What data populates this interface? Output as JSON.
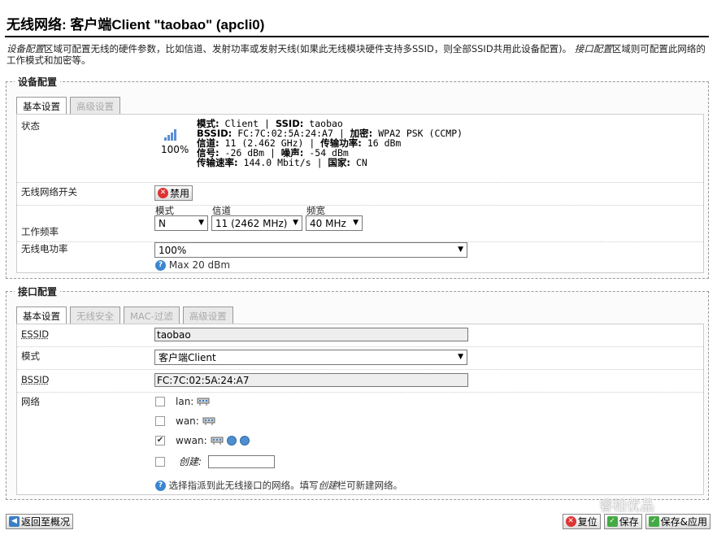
{
  "page": {
    "title": "无线网络: 客户端Client \"taobao\" (apcli0)",
    "desc_part1_italic": "设备配置",
    "desc_part1": "区域可配置无线的硬件参数，比如信道、发射功率或发射天线(如果此无线模块硬件支持多SSID，则全部SSID共用此设备配置)。",
    "desc_part2_italic": "接口配置",
    "desc_part2": "区域则可配置此网络的工作模式和加密等。"
  },
  "device_config": {
    "legend": "设备配置",
    "tabs": [
      {
        "label": "基本设置",
        "active": true
      },
      {
        "label": "高级设置",
        "active": false
      }
    ],
    "status": {
      "label": "状态",
      "signal_percent": "100%",
      "mode_label": "模式:",
      "mode_value": "Client",
      "ssid_label": "SSID:",
      "ssid_value": "taobao",
      "bssid_label": "BSSID:",
      "bssid_value": "FC:7C:02:5A:24:A7",
      "enc_label": "加密:",
      "enc_value": "WPA2 PSK (CCMP)",
      "channel_label": "信道:",
      "channel_value": "11 (2.462 GHz)",
      "txpower_label": "传输功率:",
      "txpower_value": "16 dBm",
      "signal_label": "信号:",
      "signal_value": "-26 dBm",
      "noise_label": "噪声:",
      "noise_value": "-54 dBm",
      "bitrate_label": "传输速率:",
      "bitrate_value": "144.0 Mbit/s",
      "country_label": "国家:",
      "country_value": "CN"
    },
    "wireless_switch": {
      "label": "无线网络开关",
      "button": "禁用"
    },
    "frequency": {
      "label": "工作频率",
      "mode_label": "模式",
      "mode_value": "N",
      "channel_label": "信道",
      "channel_value": "11 (2462 MHz)",
      "width_label": "频宽",
      "width_value": "40 MHz"
    },
    "power": {
      "label": "无线电功率",
      "value": "100%",
      "hint": "Max 20 dBm"
    }
  },
  "interface_config": {
    "legend": "接口配置",
    "tabs": [
      {
        "label": "基本设置",
        "active": true
      },
      {
        "label": "无线安全",
        "active": false
      },
      {
        "label": "MAC-过滤",
        "active": false
      },
      {
        "label": "高级设置",
        "active": false
      }
    ],
    "essid": {
      "label": "ESSID",
      "value": "taobao"
    },
    "mode": {
      "label": "模式",
      "value": "客户端Client"
    },
    "bssid": {
      "label": "BSSID",
      "value": "FC:7C:02:5A:24:A7"
    },
    "network": {
      "label": "网络",
      "items": [
        {
          "name": "lan:",
          "checked": false
        },
        {
          "name": "wan:",
          "checked": false
        },
        {
          "name": "wwan:",
          "checked": true
        }
      ],
      "create_label": "创建:",
      "create_value": "",
      "hint_part1": "选择指派到此无线接口的网络。填写",
      "hint_italic": "创建",
      "hint_part2": "栏可新建网络。"
    }
  },
  "footer": {
    "back": "返回至概况",
    "reset": "复位",
    "save": "保存",
    "save_apply": "保存&应用"
  },
  "watermark": "睿柏优品"
}
